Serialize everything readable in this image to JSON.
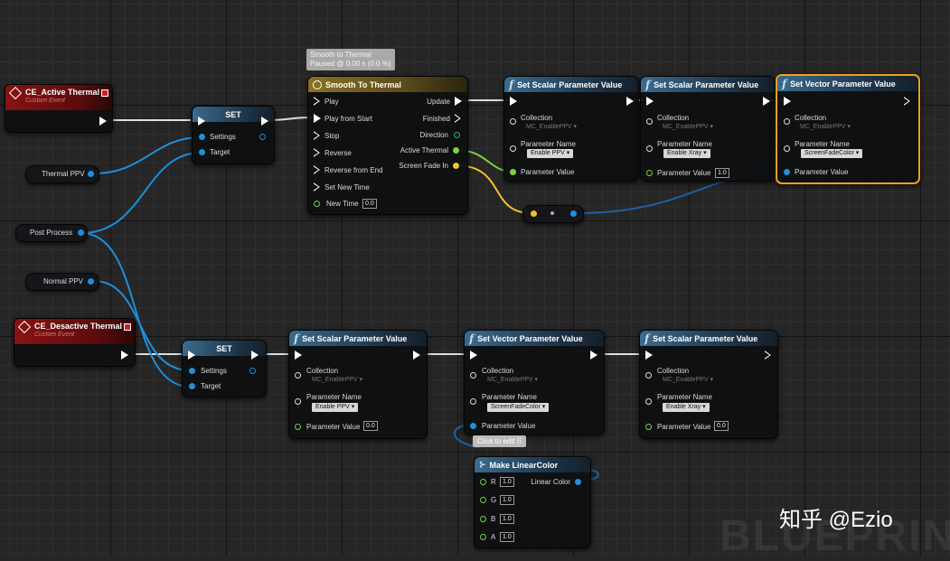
{
  "events": {
    "active": {
      "title": "CE_Active Thermal",
      "subtitle": "Custom Event"
    },
    "desactive": {
      "title": "CE_Desactive Thermal",
      "subtitle": "Custom Event"
    }
  },
  "variables": {
    "thermal_ppv": "Thermal PPV",
    "post_process": "Post Process",
    "normal_ppv": "Normal PPV"
  },
  "set_node": {
    "title": "SET",
    "settings": "Settings",
    "target": "Target"
  },
  "timeline": {
    "title": "Smooth To Thermal",
    "tooltip_line1": "Smooth to Thermal",
    "tooltip_line2": "Paused @ 0.00 s (0.0 %)",
    "inputs": [
      "Play",
      "Play from Start",
      "Stop",
      "Reverse",
      "Reverse from End",
      "Set New Time"
    ],
    "new_time_label": "New Time",
    "new_time_value": "0.0",
    "outputs": [
      "Update",
      "Finished",
      "Direction",
      "Active Thermal",
      "Screen Fade In"
    ]
  },
  "func": {
    "scalar_title": "Set Scalar Parameter Value",
    "vector_title": "Set Vector Parameter Value",
    "collection_label": "Collection",
    "collection_value": "MC_EnablePPV",
    "param_name_label": "Parameter Name",
    "param_value_label": "Parameter Value"
  },
  "top_row": {
    "n1": {
      "param": "Enable PPV"
    },
    "n2": {
      "param": "Enable Xray",
      "value": "1.0"
    },
    "n3": {
      "param": "ScreenFadeColor"
    }
  },
  "bottom_row": {
    "n1": {
      "param": "Enable PPV",
      "value": "0.0"
    },
    "n2": {
      "param": "ScreenFadeColor"
    },
    "n3": {
      "param": "Enable Xray",
      "value": "0.0"
    }
  },
  "click_tooltip": "Click to edit",
  "make_color": {
    "title": "Make LinearColor",
    "output": "Linear Color",
    "inputs": [
      {
        "label": "R",
        "value": "1.0"
      },
      {
        "label": "G",
        "value": "1.0"
      },
      {
        "label": "B",
        "value": "1.0"
      },
      {
        "label": "A",
        "value": "1.0"
      }
    ]
  },
  "watermark": "BLUEPRIN",
  "credit": "知乎 @Ezio",
  "colors": {
    "exec": "#ffffff",
    "object": "#1f8fe0",
    "float": "#7bd33e",
    "bool": "#f2c12e",
    "selected": "#f0a11c",
    "event_header": "#8a1212"
  }
}
